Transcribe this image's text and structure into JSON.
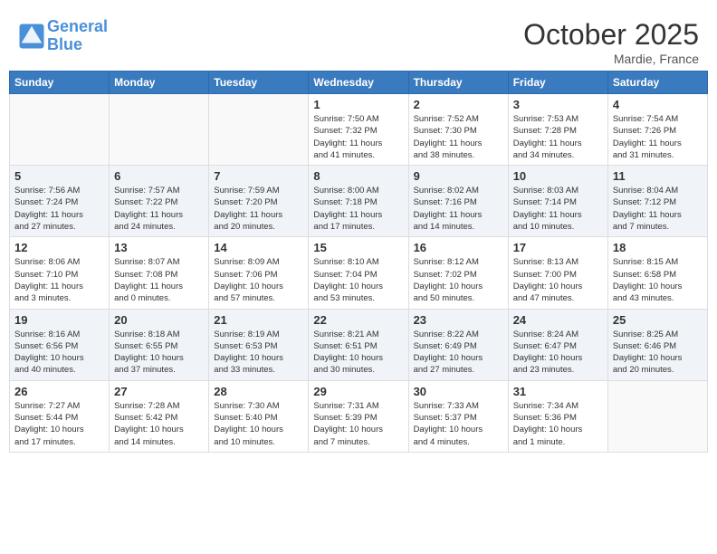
{
  "header": {
    "logo_line1": "General",
    "logo_line2": "Blue",
    "month": "October 2025",
    "location": "Mardie, France"
  },
  "days_of_week": [
    "Sunday",
    "Monday",
    "Tuesday",
    "Wednesday",
    "Thursday",
    "Friday",
    "Saturday"
  ],
  "weeks": [
    {
      "days": [
        {
          "num": "",
          "info": ""
        },
        {
          "num": "",
          "info": ""
        },
        {
          "num": "",
          "info": ""
        },
        {
          "num": "1",
          "info": "Sunrise: 7:50 AM\nSunset: 7:32 PM\nDaylight: 11 hours\nand 41 minutes."
        },
        {
          "num": "2",
          "info": "Sunrise: 7:52 AM\nSunset: 7:30 PM\nDaylight: 11 hours\nand 38 minutes."
        },
        {
          "num": "3",
          "info": "Sunrise: 7:53 AM\nSunset: 7:28 PM\nDaylight: 11 hours\nand 34 minutes."
        },
        {
          "num": "4",
          "info": "Sunrise: 7:54 AM\nSunset: 7:26 PM\nDaylight: 11 hours\nand 31 minutes."
        }
      ]
    },
    {
      "days": [
        {
          "num": "5",
          "info": "Sunrise: 7:56 AM\nSunset: 7:24 PM\nDaylight: 11 hours\nand 27 minutes."
        },
        {
          "num": "6",
          "info": "Sunrise: 7:57 AM\nSunset: 7:22 PM\nDaylight: 11 hours\nand 24 minutes."
        },
        {
          "num": "7",
          "info": "Sunrise: 7:59 AM\nSunset: 7:20 PM\nDaylight: 11 hours\nand 20 minutes."
        },
        {
          "num": "8",
          "info": "Sunrise: 8:00 AM\nSunset: 7:18 PM\nDaylight: 11 hours\nand 17 minutes."
        },
        {
          "num": "9",
          "info": "Sunrise: 8:02 AM\nSunset: 7:16 PM\nDaylight: 11 hours\nand 14 minutes."
        },
        {
          "num": "10",
          "info": "Sunrise: 8:03 AM\nSunset: 7:14 PM\nDaylight: 11 hours\nand 10 minutes."
        },
        {
          "num": "11",
          "info": "Sunrise: 8:04 AM\nSunset: 7:12 PM\nDaylight: 11 hours\nand 7 minutes."
        }
      ]
    },
    {
      "days": [
        {
          "num": "12",
          "info": "Sunrise: 8:06 AM\nSunset: 7:10 PM\nDaylight: 11 hours\nand 3 minutes."
        },
        {
          "num": "13",
          "info": "Sunrise: 8:07 AM\nSunset: 7:08 PM\nDaylight: 11 hours\nand 0 minutes."
        },
        {
          "num": "14",
          "info": "Sunrise: 8:09 AM\nSunset: 7:06 PM\nDaylight: 10 hours\nand 57 minutes."
        },
        {
          "num": "15",
          "info": "Sunrise: 8:10 AM\nSunset: 7:04 PM\nDaylight: 10 hours\nand 53 minutes."
        },
        {
          "num": "16",
          "info": "Sunrise: 8:12 AM\nSunset: 7:02 PM\nDaylight: 10 hours\nand 50 minutes."
        },
        {
          "num": "17",
          "info": "Sunrise: 8:13 AM\nSunset: 7:00 PM\nDaylight: 10 hours\nand 47 minutes."
        },
        {
          "num": "18",
          "info": "Sunrise: 8:15 AM\nSunset: 6:58 PM\nDaylight: 10 hours\nand 43 minutes."
        }
      ]
    },
    {
      "days": [
        {
          "num": "19",
          "info": "Sunrise: 8:16 AM\nSunset: 6:56 PM\nDaylight: 10 hours\nand 40 minutes."
        },
        {
          "num": "20",
          "info": "Sunrise: 8:18 AM\nSunset: 6:55 PM\nDaylight: 10 hours\nand 37 minutes."
        },
        {
          "num": "21",
          "info": "Sunrise: 8:19 AM\nSunset: 6:53 PM\nDaylight: 10 hours\nand 33 minutes."
        },
        {
          "num": "22",
          "info": "Sunrise: 8:21 AM\nSunset: 6:51 PM\nDaylight: 10 hours\nand 30 minutes."
        },
        {
          "num": "23",
          "info": "Sunrise: 8:22 AM\nSunset: 6:49 PM\nDaylight: 10 hours\nand 27 minutes."
        },
        {
          "num": "24",
          "info": "Sunrise: 8:24 AM\nSunset: 6:47 PM\nDaylight: 10 hours\nand 23 minutes."
        },
        {
          "num": "25",
          "info": "Sunrise: 8:25 AM\nSunset: 6:46 PM\nDaylight: 10 hours\nand 20 minutes."
        }
      ]
    },
    {
      "days": [
        {
          "num": "26",
          "info": "Sunrise: 7:27 AM\nSunset: 5:44 PM\nDaylight: 10 hours\nand 17 minutes."
        },
        {
          "num": "27",
          "info": "Sunrise: 7:28 AM\nSunset: 5:42 PM\nDaylight: 10 hours\nand 14 minutes."
        },
        {
          "num": "28",
          "info": "Sunrise: 7:30 AM\nSunset: 5:40 PM\nDaylight: 10 hours\nand 10 minutes."
        },
        {
          "num": "29",
          "info": "Sunrise: 7:31 AM\nSunset: 5:39 PM\nDaylight: 10 hours\nand 7 minutes."
        },
        {
          "num": "30",
          "info": "Sunrise: 7:33 AM\nSunset: 5:37 PM\nDaylight: 10 hours\nand 4 minutes."
        },
        {
          "num": "31",
          "info": "Sunrise: 7:34 AM\nSunset: 5:36 PM\nDaylight: 10 hours\nand 1 minute."
        },
        {
          "num": "",
          "info": ""
        }
      ]
    }
  ]
}
